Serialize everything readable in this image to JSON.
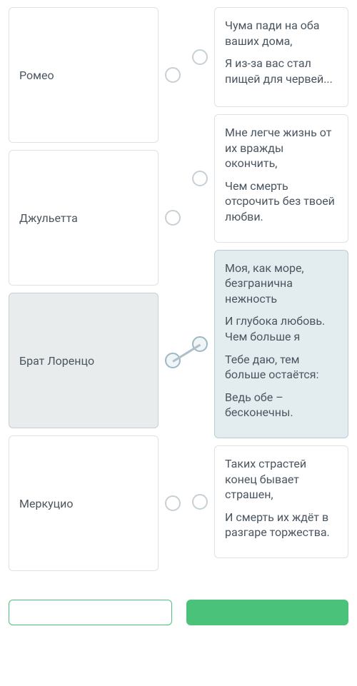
{
  "left_items": [
    {
      "label": "Ромео",
      "selected": false
    },
    {
      "label": "Джульетта",
      "selected": false
    },
    {
      "label": "Брат Лоренцо",
      "selected": true
    },
    {
      "label": "Меркуцио",
      "selected": false
    }
  ],
  "right_items": [
    {
      "lines": [
        "Чума пади на оба ваших дома,",
        "Я из-за вас стал пищей для червей..."
      ],
      "selected": false
    },
    {
      "lines": [
        "Мне легче жизнь от их вражды окончить,",
        "Чем смерть отсрочить без твоей любви."
      ],
      "selected": false
    },
    {
      "lines": [
        "Моя, как море, безгранична нежность",
        "И глубока любовь. Чем больше я",
        "Тебе даю, тем больше остаётся:",
        "Ведь обе – бесконечны."
      ],
      "selected": true
    },
    {
      "lines": [
        "Таких страстей конец бывает страшен,",
        "И смерть их ждёт в разгаре торжества."
      ],
      "selected": false
    }
  ],
  "connection": {
    "from": 2,
    "to": 2
  }
}
